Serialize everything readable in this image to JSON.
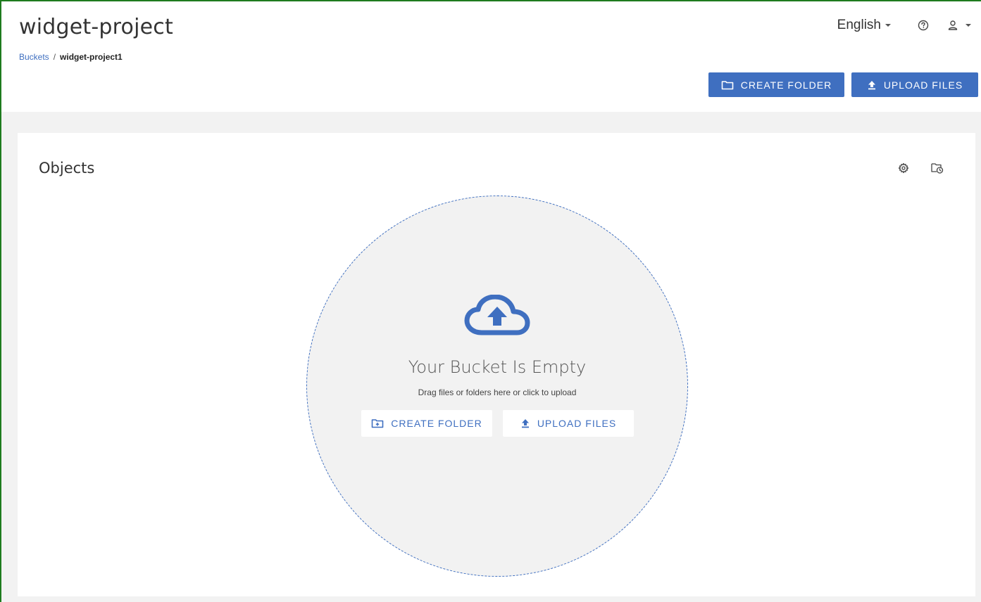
{
  "header": {
    "title": "widget-project",
    "breadcrumb": {
      "root": "Buckets",
      "separator": "/",
      "current": "widget-project1"
    },
    "language": "English",
    "create_folder_label": "CREATE FOLDER",
    "upload_files_label": "UPLOAD FILES"
  },
  "objects": {
    "title": "Objects",
    "empty_title": "Your Bucket Is Empty",
    "empty_subtitle": "Drag files or folders here or click to upload",
    "create_folder_label": "CREATE FOLDER",
    "upload_files_label": "UPLOAD FILES"
  },
  "icons": {
    "help": "help-circle-icon",
    "user": "user-icon",
    "settings": "gear-icon",
    "history": "folder-clock-icon",
    "folder": "folder-icon",
    "upload": "upload-arrow-icon",
    "cloud": "cloud-upload-icon"
  },
  "colors": {
    "accent": "#3f6fc0",
    "frame": "#1e7b1e",
    "background": "#f2f2f2"
  }
}
